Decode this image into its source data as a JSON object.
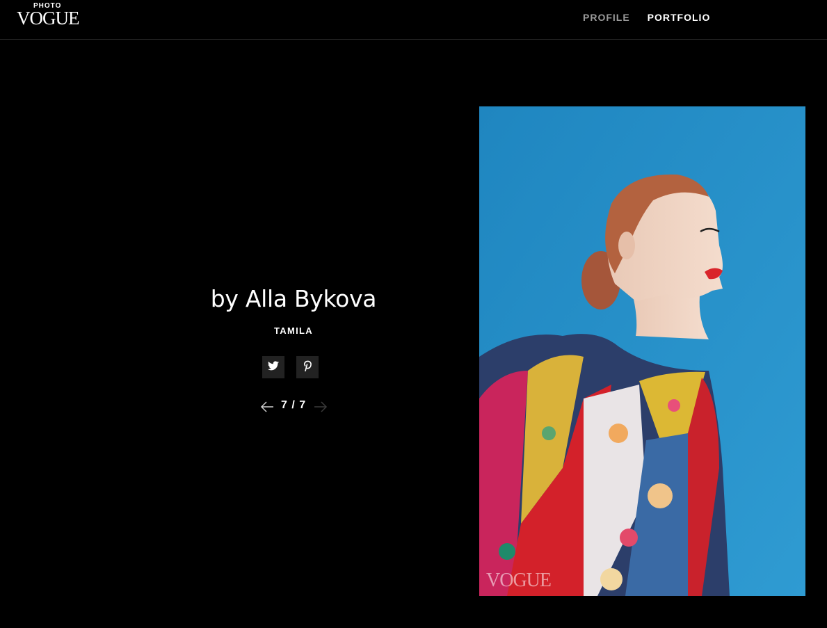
{
  "brand": {
    "logo_small": "PHOTO",
    "logo_big": "VOGUE"
  },
  "nav": {
    "items": [
      {
        "label": "PROFILE",
        "color": "#9a9a9a"
      },
      {
        "label": "PORTFOLIO",
        "color": "#ffffff"
      }
    ]
  },
  "main": {
    "title": "by Alla Bykova",
    "subtitle": "TAMILA",
    "share": {
      "buttons": [
        {
          "icon": "twitter-icon"
        },
        {
          "icon": "pinterest-icon"
        }
      ]
    },
    "pager": {
      "count": "7 / 7",
      "prev_icon": "arrow-left-icon",
      "next_icon": "arrow-right-icon"
    }
  },
  "photo": {
    "watermark": "VOGUE",
    "background_color": "#2a8fc6"
  },
  "colors": {
    "background": "#000000",
    "text": "#ffffff",
    "nav_inactive": "#9a9a9a",
    "share_button_bg": "#222222"
  }
}
